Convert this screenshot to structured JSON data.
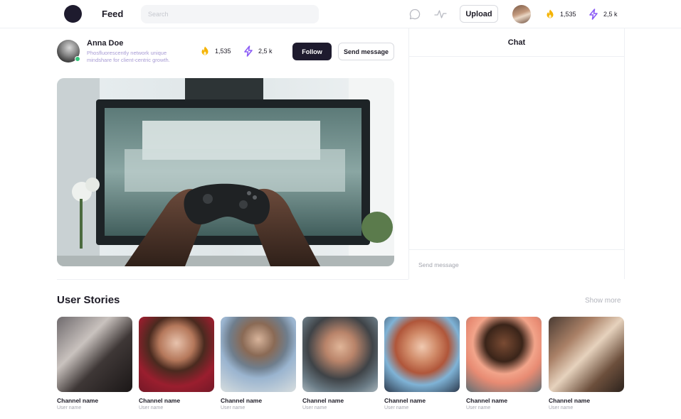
{
  "header": {
    "title": "Feed",
    "search_placeholder": "Search",
    "upload_label": "Upload",
    "coins": "1,535",
    "energy": "2,5 k",
    "icons": [
      "logo",
      "chat-bubble-icon",
      "activity-icon",
      "avatar",
      "coin-icon",
      "lightning-icon"
    ]
  },
  "profile": {
    "name": "Anna Doe",
    "bio": "Phosfluorescently network unique mindshare for client-centric growth.",
    "coins": "1,535",
    "energy": "2,5 k",
    "follow_label": "Follow",
    "send_message_label": "Send message",
    "online": true
  },
  "video": {
    "description": "gamer-hands-holding-controller"
  },
  "chat": {
    "title": "Chat",
    "input_placeholder": "Send message"
  },
  "stories": {
    "title": "User Stories",
    "show_more_label": "Show more",
    "items": [
      {
        "channel": "Channel name",
        "user": "User name"
      },
      {
        "channel": "Channel name",
        "user": "User name"
      },
      {
        "channel": "Channel name",
        "user": "User name"
      },
      {
        "channel": "Channel name",
        "user": "User name"
      },
      {
        "channel": "Channel name",
        "user": "User name"
      },
      {
        "channel": "Channel name",
        "user": "User name"
      },
      {
        "channel": "Channel name",
        "user": "User name"
      }
    ]
  },
  "colors": {
    "primary_dark": "#1e1b2e",
    "bio_text": "#a79bd4",
    "coin": "#f5b301",
    "lightning": "#8b5cf6",
    "online": "#34c47a"
  }
}
